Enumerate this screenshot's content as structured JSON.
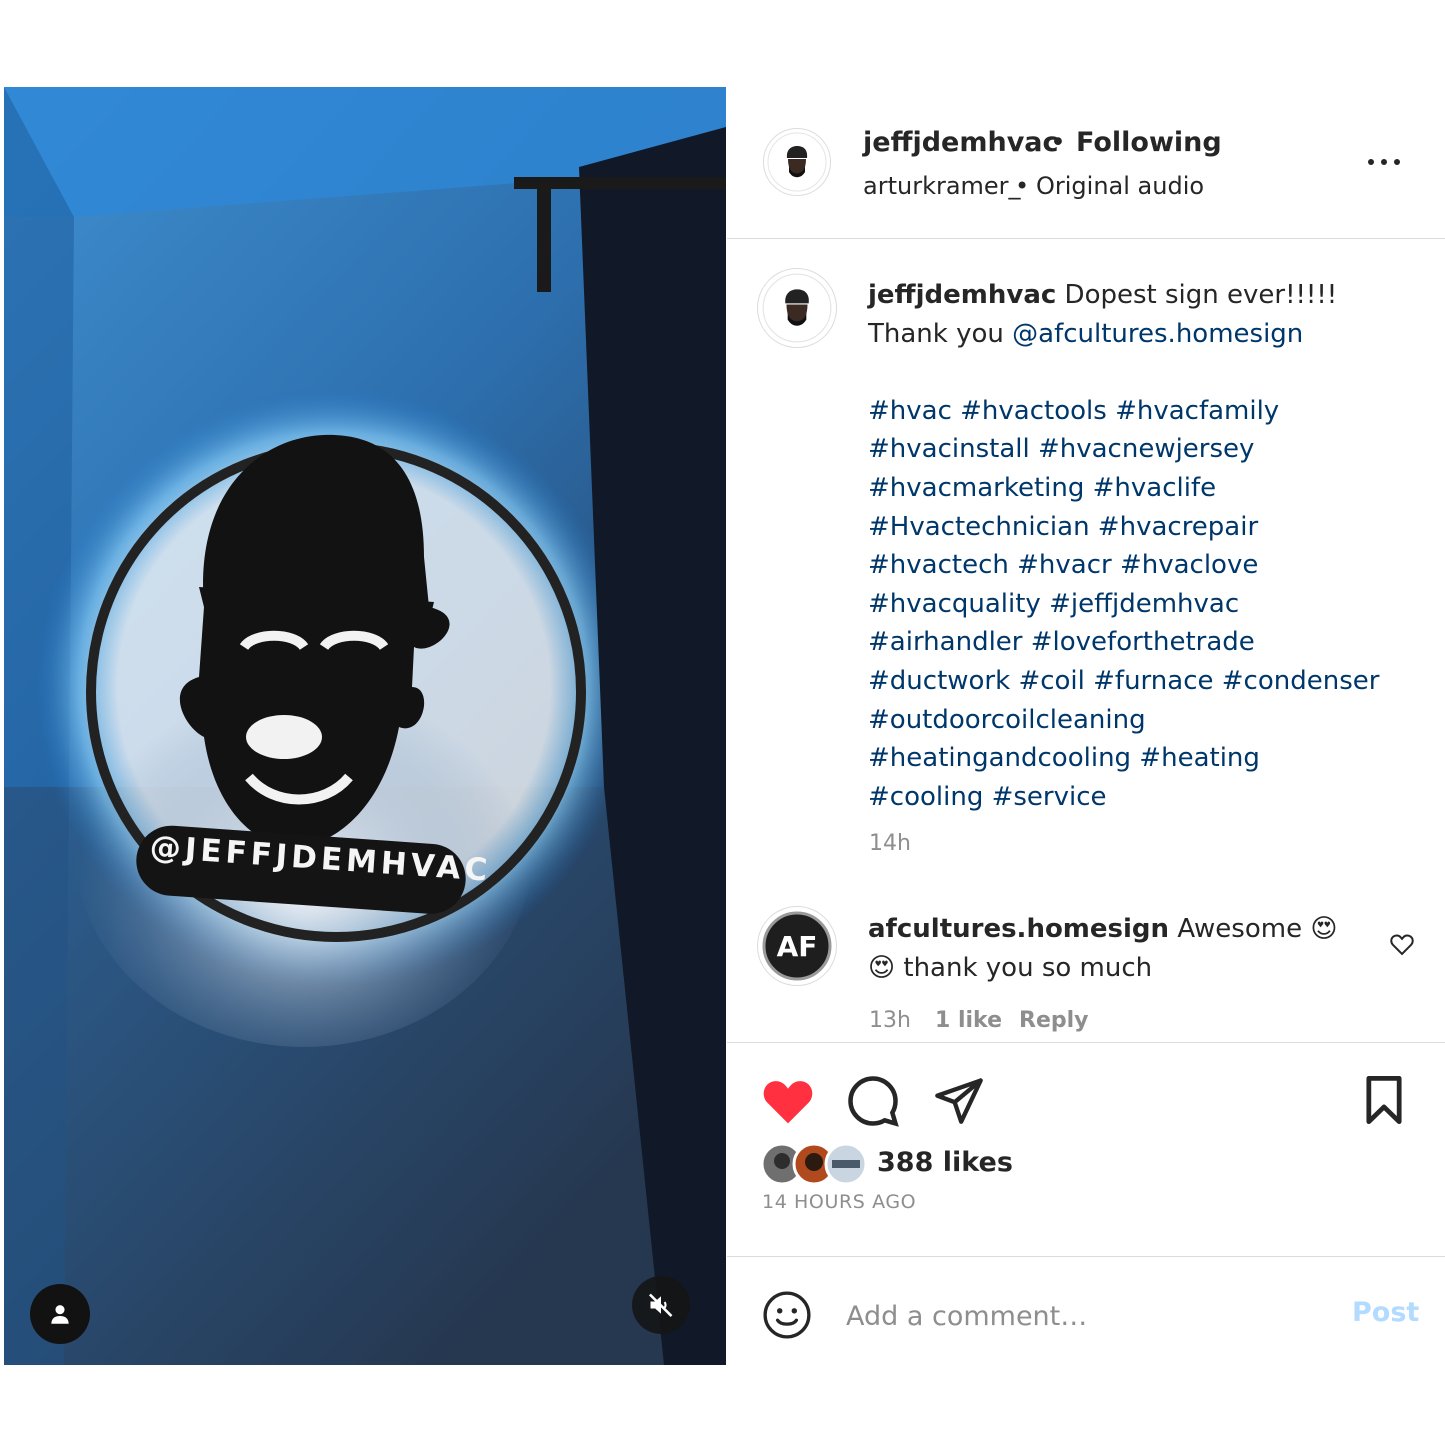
{
  "header": {
    "username": "jeffjdemhvac",
    "separator": "•",
    "follow_status": "Following",
    "audio_user": "arturkramer_",
    "audio_separator": "•",
    "audio_title": "Original audio",
    "more_icon": "more-horizontal-icon"
  },
  "media": {
    "sign_text": "@JEFFJDEMHVAC",
    "user_tag_icon": "person-icon",
    "mute_icon": "speaker-muted-icon"
  },
  "caption": {
    "username": "jeffjdemhvac",
    "lines": [
      "Dopest sign ever!!!!!",
      "Thank you @afcultures.homesign",
      "",
      "#hvac #hvactools #hvacfamily",
      "#hvacinstall #hvacnewjersey",
      "#hvacmarketing #hvaclife",
      "#Hvactechnician #hvacrepair",
      "#hvactech #hvacr #hvaclove",
      "#hvacquality #jeffjdemhvac",
      "#airhandler #loveforthetrade",
      "#ductwork #coil #furnace #condenser",
      "#outdoorcoilcleaning",
      "#heatingandcooling #heating",
      "#cooling #service"
    ],
    "thank_prefix": "Thank you ",
    "mention": "@afcultures.homesign",
    "time": "14h"
  },
  "comment": {
    "username": "afcultures.homesign",
    "text_line1": "Awesome",
    "emoji": "😍",
    "text_line2": "thank you so much",
    "time": "13h",
    "likes": "1 like",
    "reply": "Reply",
    "like_icon": "heart-outline-icon"
  },
  "actions": {
    "like_icon": "heart-filled-icon",
    "comment_icon": "comment-icon",
    "share_icon": "send-icon",
    "save_icon": "bookmark-icon",
    "like_color": "#ff3040"
  },
  "likes": {
    "count_text": "388 likes",
    "time_ago": "14 HOURS AGO"
  },
  "add_comment": {
    "emoji_icon": "smiley-icon",
    "placeholder": "Add a comment…",
    "post_label": "Post",
    "post_color": "#b3dbff"
  }
}
